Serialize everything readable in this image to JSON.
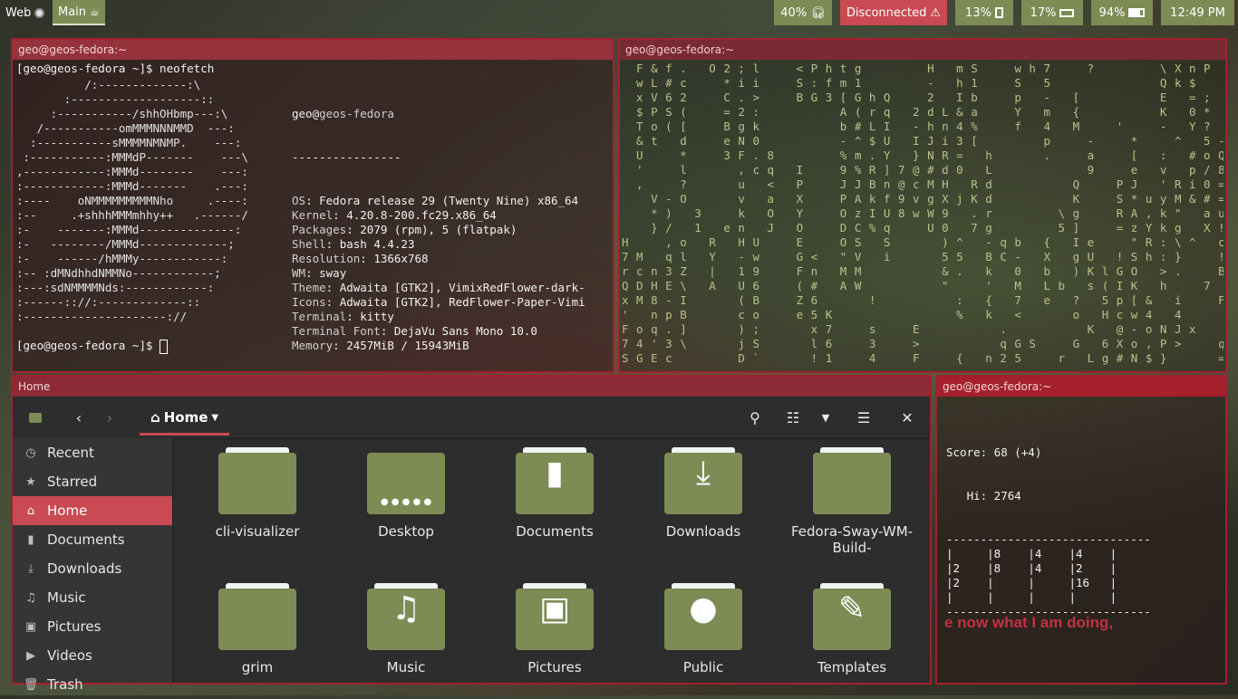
{
  "topbar": {
    "workspaces": [
      {
        "label": "Web"
      },
      {
        "label": "Main"
      }
    ],
    "modules": {
      "volume": "40%",
      "network": "Disconnected",
      "cpu": "13%",
      "memory": "17%",
      "battery": "94%",
      "clock": "12:49 PM"
    }
  },
  "terminal_neofetch": {
    "title": "geo@geos-fedora:~",
    "prompt": "[geo@geos-fedora ~]$ neofetch",
    "logo": "          /:-------------:\\\n       :-------------------::\n     :-----------/shhOHbmp---:\\\n   /-----------omMMMNNNMMD  ---:\n  :-----------sMMMMNMNMP.    ---:\n :-----------:MMMdP-------    ---\\\n,------------:MMMd--------    ---:\n:------------:MMMd-------    .---:\n:----    oNMMMMMMMMMNho     .----:\n:--     .+shhhMMMmhhy++   .------/\n:-    -------:MMMd--------------:\n:-   --------/MMMd-------------;\n:-    ------/hMMMy------------:\n:-- :dMNdhhdNMMNo------------;\n:---:sdNMMMMNds:------------:\n:------:://:-------------::\n:---------------------://",
    "user": "geo",
    "at": "@",
    "host": "geos-fedora",
    "rule": "----------------",
    "info": [
      {
        "key": "OS",
        "value": "Fedora release 29 (Twenty Nine) x86_64"
      },
      {
        "key": "Kernel",
        "value": "4.20.8-200.fc29.x86_64"
      },
      {
        "key": "Packages",
        "value": "2079 (rpm), 5 (flatpak)"
      },
      {
        "key": "Shell",
        "value": "bash 4.4.23"
      },
      {
        "key": "Resolution",
        "value": "1366x768"
      },
      {
        "key": "WM",
        "value": "sway"
      },
      {
        "key": "Theme",
        "value": "Adwaita [GTK2], VimixRedFlower-dark-"
      },
      {
        "key": "Icons",
        "value": "Adwaita [GTK2], RedFlower-Paper-Vimi"
      },
      {
        "key": "Terminal",
        "value": "kitty"
      },
      {
        "key": "Terminal Font",
        "value": "DejaVu Sans Mono 10.0"
      },
      {
        "key": "Memory",
        "value": "2457MiB / 15943MiB"
      }
    ],
    "palette": [
      "#a3323a",
      "#7d8b55",
      "#b8a84a",
      "#4d4b63",
      "#d69aa7",
      "#4f4d5e",
      "#f7dbe3"
    ],
    "prompt2": "[geo@geos-fedora ~]$ "
  },
  "terminal_matrix": {
    "title": "geo@geos-fedora:~",
    "rain": "  F & f .   O 2 ; l     < P h t g         H   m S     w h 7     ?         \\ X n P\n  w L # c     * i i     S : f m 1         -   h 1     S   5               Q k $\n  x V 6 2     C . >     B G 3 [ G h Q     2   I b     p   -   [           E   = ;\n  $ P S (     = 2 :           A ( r q   2 d L & a     Y   m   {           K   0 *\n  T o ( [     B g k           b # L I   - h n 4 %     f   4   M     '     -   Y ?\n  & t   d     e N 0           - ^ $ U   I J i 3 [         p     -     *     ^   5 -\n  U     *     3 F . 8         % m . Y   } N R =   h       .     a     [   :   # o Q\n  '     l       , c q   I     9 % R ] 7 @ # d 0   L             9     e   v   p / 8\n  ,     ?       u   <   P     J J B n @ c M H   R d           Q     P J   ' R i 0 =\n    V - O       v   a   X     P A k f 9 v g X j K d           K     S * u y M & # =\n    * )   3     k   O   Y     O z I U 8 w W 9   . r         \\ g     R A , k \"   a u\n    } /   1   e n   J   O     D C % q     U 0   7 g         5 ]     = z Y k g   X !\nH     , o   R   H U     E     O S   S       ) ^   - q b   {   I e     \" R : \\ ^   c }\n7 M   q l   Y   - w     G <   \" V   i       5 5   B C -   X   g U   ! S h : }     !\nr c n 3 Z   |   1 9     F n   M M           & .   k   0   b   ) K l G O   > .     B\nQ D H E \\   A   U 6     ( #   A W           \"     '   M   L b   s ( I K   h     7\nx M 8 - I       ( B     Z 6       !           :   {   7   e   ?   5 p [ &   i     F\n'   n p B       c o     e 5 K                 %   k   <       o   H c w 4   4\nF o q . ]       ) ;       x 7     s     E           .           K   @ - o N J x     F\n7 4 ' 3 \\       j S       l 6     3     >           q G S     G   6 X o , P >     q\nS G E c         D `       ! 1     4     F     {   n 2 5     r   L g # N $ }       ="
  },
  "file_manager": {
    "title": "Home",
    "location": "Home",
    "sidebar": [
      {
        "label": "Recent",
        "icon": "clock-icon"
      },
      {
        "label": "Starred",
        "icon": "star-icon"
      },
      {
        "label": "Home",
        "icon": "home-icon",
        "active": true
      },
      {
        "label": "Documents",
        "icon": "document-icon"
      },
      {
        "label": "Downloads",
        "icon": "download-icon"
      },
      {
        "label": "Music",
        "icon": "music-icon"
      },
      {
        "label": "Pictures",
        "icon": "picture-icon"
      },
      {
        "label": "Videos",
        "icon": "video-icon"
      },
      {
        "label": "Trash",
        "icon": "trash-icon"
      }
    ],
    "items": [
      {
        "label": "cli-visualizer",
        "icon": "folder-icon"
      },
      {
        "label": "Desktop",
        "icon": "desktop-folder-icon"
      },
      {
        "label": "Documents",
        "icon": "documents-folder-icon"
      },
      {
        "label": "Downloads",
        "icon": "downloads-folder-icon"
      },
      {
        "label": "Fedora-Sway-WM-Build-",
        "icon": "folder-icon"
      },
      {
        "label": "grim",
        "icon": "folder-icon"
      },
      {
        "label": "Music",
        "icon": "music-folder-icon"
      },
      {
        "label": "Pictures",
        "icon": "pictures-folder-icon"
      },
      {
        "label": "Public",
        "icon": "public-folder-icon"
      },
      {
        "label": "Templates",
        "icon": "templates-folder-icon"
      }
    ]
  },
  "terminal_game": {
    "title": "geo@geos-fedora:~",
    "score": "Score: 68 (+4)",
    "hi": "   Hi: 2764",
    "board": "------------------------------\n|     |8    |4    |4    |\n|2    |8    |4    |2    |\n|2    |     |     |16   |\n|     |     |     |     |\n------------------------------",
    "quote": "e now what I am doing,"
  },
  "colors": {
    "accent": "#c94a52",
    "folder": "#7d8b55",
    "border": "#a3202e"
  }
}
